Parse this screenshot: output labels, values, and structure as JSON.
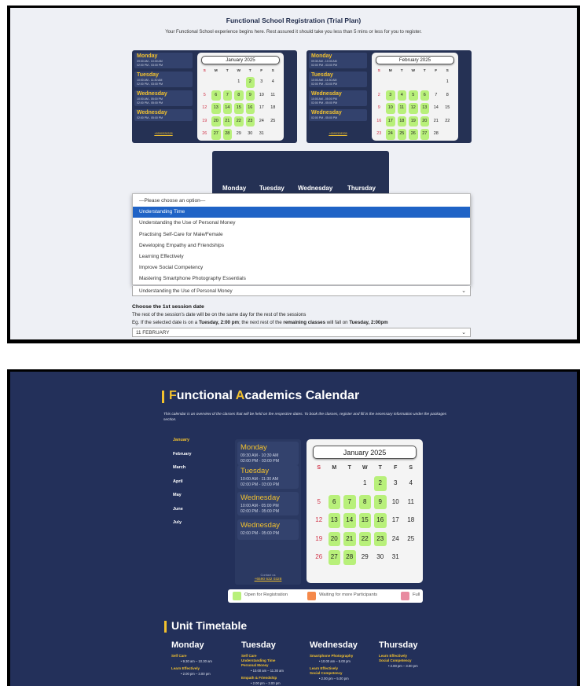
{
  "shot1": {
    "title": "Functional School Registration (Trial Plan)",
    "subtitle": "Your Functional School experience begins here. Rest assured it should take you less than 5 mins or less for you to register.",
    "mini_calendars": [
      {
        "days": [
          {
            "name": "Monday",
            "times": [
              "09:30 AM - 10:30 AM",
              "02:00 PM - 03:00 PM"
            ]
          },
          {
            "name": "Tuesday",
            "times": [
              "10:00 AM - 11:30 AM",
              "02:00 PM - 03:00 PM"
            ]
          },
          {
            "name": "Wednesday",
            "times": [
              "10:00 AM - 05:00 PM",
              "02:00 PM - 05:00 PM"
            ]
          },
          {
            "name": "Wednesday",
            "times": [
              "02:00 PM - 05:00 PM"
            ]
          }
        ],
        "phone": "+6590328328",
        "month": "January 2025",
        "weekdays": [
          "S",
          "M",
          "T",
          "W",
          "T",
          "F",
          "S"
        ],
        "weeks": [
          [
            "",
            "",
            "",
            "1",
            "2",
            "3",
            "4"
          ],
          [
            "5",
            "6",
            "7",
            "8",
            "9",
            "10",
            "11"
          ],
          [
            "12",
            "13",
            "14",
            "15",
            "16",
            "17",
            "18"
          ],
          [
            "19",
            "20",
            "21",
            "22",
            "23",
            "24",
            "25"
          ],
          [
            "26",
            "27",
            "28",
            "29",
            "30",
            "31",
            ""
          ]
        ],
        "highlighted": [
          "2",
          "6",
          "7",
          "8",
          "9",
          "13",
          "14",
          "15",
          "16",
          "20",
          "21",
          "22",
          "23",
          "27",
          "28"
        ]
      },
      {
        "days": [
          {
            "name": "Monday",
            "times": [
              "09:30 AM - 10:30 AM",
              "02:00 PM - 03:00 PM"
            ]
          },
          {
            "name": "Tuesday",
            "times": [
              "10:00 AM - 11:30 AM",
              "02:00 PM - 03:00 PM"
            ]
          },
          {
            "name": "Wednesday",
            "times": [
              "10:00 AM - 05:00 PM",
              "02:00 PM - 05:00 PM"
            ]
          },
          {
            "name": "Wednesday",
            "times": [
              "02:00 PM - 05:00 PM"
            ]
          }
        ],
        "phone": "+6590328328",
        "month": "February 2025",
        "weekdays": [
          "S",
          "M",
          "T",
          "W",
          "T",
          "F",
          "S"
        ],
        "weeks": [
          [
            "",
            "",
            "",
            "",
            "",
            "",
            "1"
          ],
          [
            "2",
            "3",
            "4",
            "5",
            "6",
            "7",
            "8"
          ],
          [
            "9",
            "10",
            "11",
            "12",
            "13",
            "14",
            "15"
          ],
          [
            "16",
            "17",
            "18",
            "19",
            "20",
            "21",
            "22"
          ],
          [
            "23",
            "24",
            "25",
            "26",
            "27",
            "28",
            ""
          ]
        ],
        "highlighted": [
          "3",
          "4",
          "5",
          "6",
          "10",
          "11",
          "12",
          "13",
          "17",
          "18",
          "19",
          "20",
          "24",
          "25",
          "26",
          "27"
        ]
      }
    ],
    "timetable_days": [
      "Monday",
      "Tuesday",
      "Wednesday",
      "Thursday"
    ],
    "dropdown_options": [
      "—Please choose an option—",
      "Understanding Time",
      "Understanding the Use of Personal Money",
      "Practising Self-Care for Male/Female",
      "Developing Empathy and Friendships",
      "Learning Effectively",
      "Improve Social Competency",
      "Mastering Smartphone Photography Essentials"
    ],
    "dropdown_highlighted_index": 1,
    "course_select_value": "Understanding the Use of Personal Money",
    "session_heading": "Choose the 1st session date",
    "session_note": "The rest of the session's date will be on the same day for the rest of the sessions",
    "example_prefix": "Eg. If the selected date is on a ",
    "example_day1": "Tuesday, 2:00 pm",
    "example_mid": "; the next rest of the ",
    "example_bold": "remaining classes",
    "example_mid2": " will fall on ",
    "example_day2": "Tuesday, 2:00pm",
    "date_select_value": "11 FEBRUARY"
  },
  "shot2": {
    "title_parts": [
      "F",
      "unctional ",
      "A",
      "cademics Calendar"
    ],
    "intro": "This calendar is an overview of the classes that will be held on the respective dates. To book the classes, register and fill in the necessary information under the packages section.",
    "months": [
      "January",
      "February",
      "March",
      "April",
      "May",
      "June",
      "July"
    ],
    "active_month": "January",
    "days": [
      {
        "name": "Monday",
        "times": [
          "09:30 AM - 10:30 AM",
          "02:00 PM - 03:00 PM"
        ]
      },
      {
        "name": "Tuesday",
        "times": [
          "10:00 AM - 11:30 AM",
          "02:00 PM - 03:00 PM"
        ]
      },
      {
        "name": "Wednesday",
        "times": [
          "10:00 AM - 05:00 PM",
          "02:00 PM - 05:00 PM"
        ]
      },
      {
        "name": "Wednesday",
        "times": [
          "02:00 PM - 05:00 PM"
        ]
      }
    ],
    "contact_label": "Contact us",
    "phone": "+6590 632 0328",
    "calendar": {
      "month": "January 2025",
      "weekdays": [
        "S",
        "M",
        "T",
        "W",
        "T",
        "F",
        "S"
      ],
      "weeks": [
        [
          "",
          "",
          "",
          "1",
          "2",
          "3",
          "4"
        ],
        [
          "5",
          "6",
          "7",
          "8",
          "9",
          "10",
          "11"
        ],
        [
          "12",
          "13",
          "14",
          "15",
          "16",
          "17",
          "18"
        ],
        [
          "19",
          "20",
          "21",
          "22",
          "23",
          "24",
          "25"
        ],
        [
          "26",
          "27",
          "28",
          "29",
          "30",
          "31",
          ""
        ]
      ],
      "highlighted": [
        "2",
        "6",
        "7",
        "8",
        "9",
        "13",
        "14",
        "15",
        "16",
        "20",
        "21",
        "22",
        "23",
        "27",
        "28"
      ]
    },
    "legend": [
      {
        "label": "Open for Registration",
        "color": "#b8f07a"
      },
      {
        "label": "Waiting for more Participants",
        "color": "#f5894a"
      },
      {
        "label": "Full",
        "color": "#e88aa0"
      }
    ],
    "unit_title": "Unit Timetable",
    "timetable": [
      {
        "day": "Monday",
        "entries": [
          {
            "subjects": [
              "Self Care"
            ],
            "time": "9.30 am – 10.30 am"
          },
          {
            "subjects": [
              "Learn Effectively"
            ],
            "time": "2.00 pm – 3.00 pm"
          }
        ]
      },
      {
        "day": "Tuesday",
        "entries": [
          {
            "subjects": [
              "Self Care",
              "Understanding Time",
              "Personal Money"
            ],
            "time": "10.00 am – 11.30 am"
          },
          {
            "subjects": [
              "Empath & Friendship"
            ],
            "time": "2.00 pm – 3.00 pm"
          }
        ]
      },
      {
        "day": "Wednesday",
        "entries": [
          {
            "subjects": [
              "Smartphone Photography"
            ],
            "time": "10.00 am – 5.00 pm"
          },
          {
            "subjects": [
              "Learn Effectively",
              "Social Competency"
            ],
            "time": "2.00 pm – 5.00 pm"
          }
        ]
      },
      {
        "day": "Thursday",
        "entries": [
          {
            "subjects": [
              "Learn Effectively",
              "Social Competency"
            ],
            "time": "2.00 pm – 3.00 pm"
          }
        ]
      }
    ],
    "colors": {
      "navy": "#23305a",
      "accent": "#f2c12e",
      "open": "#b8f07a"
    }
  }
}
